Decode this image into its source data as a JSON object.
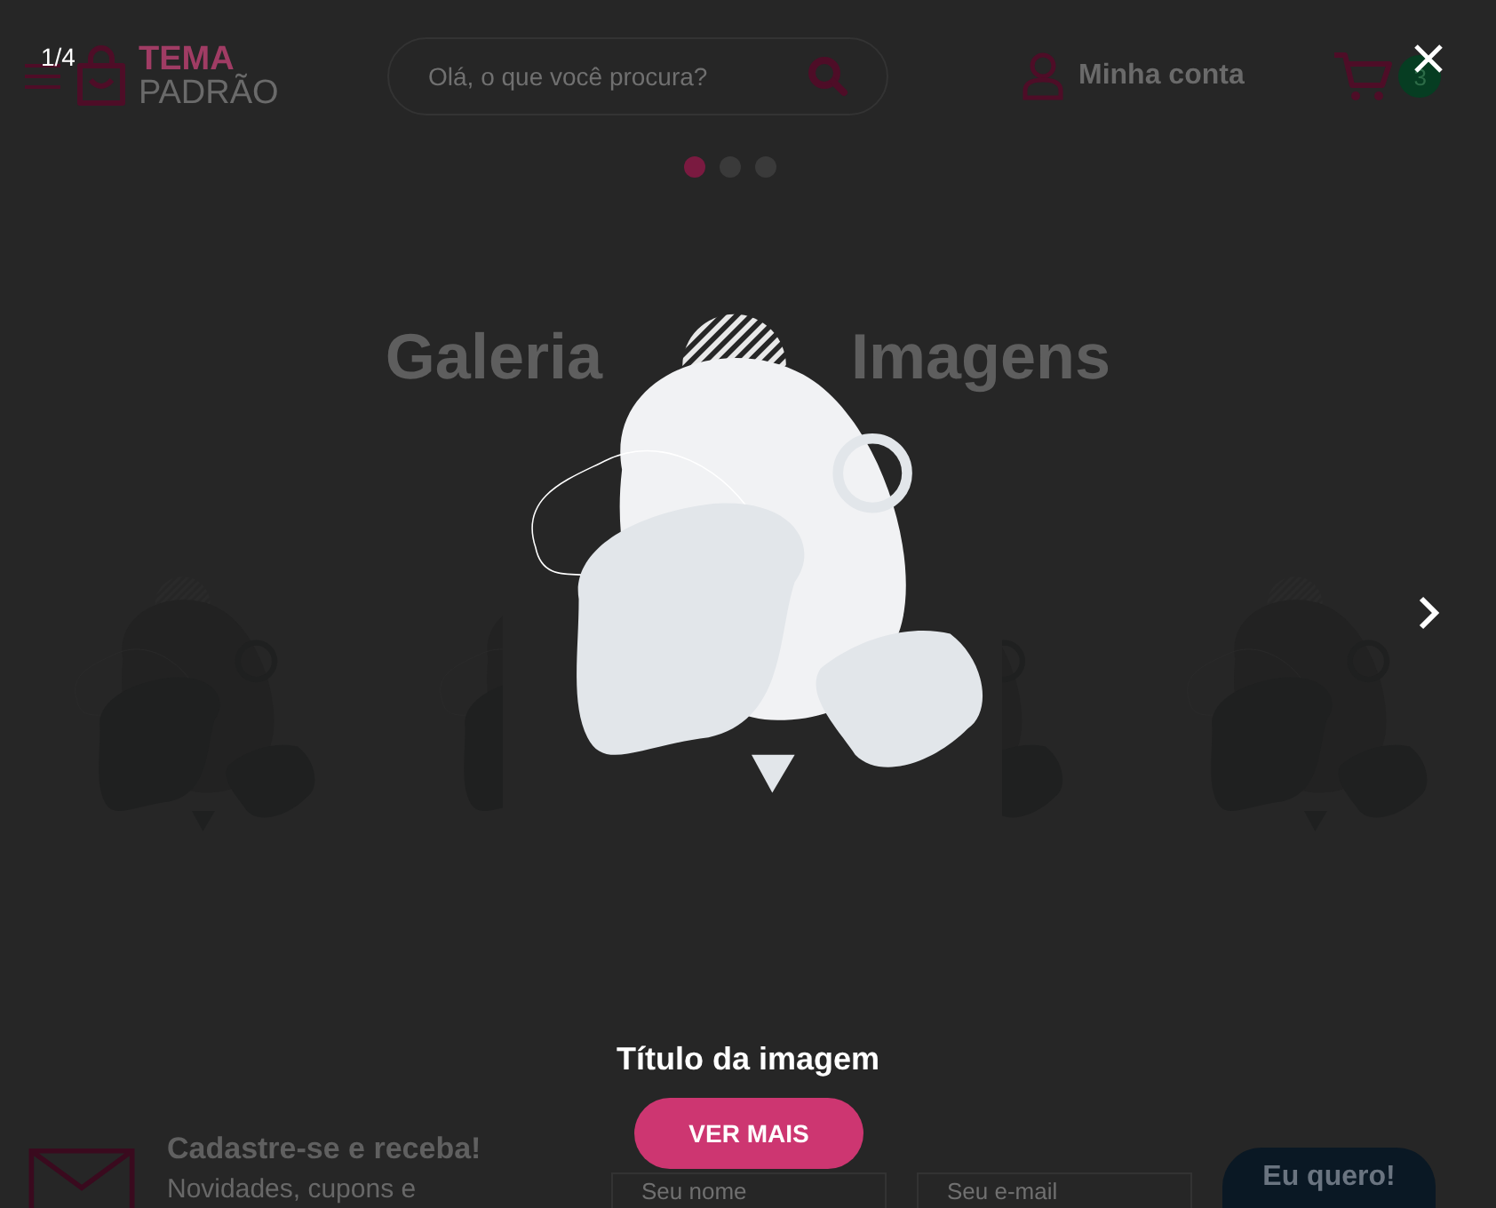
{
  "header": {
    "logo": {
      "line_1": "TEMA",
      "line_2": "PADRÃO"
    },
    "search": {
      "placeholder": "Olá, o que você procura?"
    },
    "account": "Minha conta",
    "cart_count": "3"
  },
  "banner_dots": [
    {
      "selected": true
    },
    {
      "selected": false
    },
    {
      "selected": false
    }
  ],
  "gallery": {
    "title_parts": [
      "Galeria",
      "Imagens"
    ],
    "thumbnails": [
      {
        "kind": "picture"
      },
      {
        "kind": "picture"
      },
      {
        "kind": "picture"
      },
      {
        "kind": "picture"
      }
    ]
  },
  "newsletter": {
    "title": "Cadastre-se e receba!",
    "text": "Novidades, cupons e",
    "name_field": {
      "placeholder": "Seu nome"
    },
    "email_field": {
      "placeholder": "Seu e-mail"
    },
    "button": "Eu quero!"
  },
  "lightbox": {
    "counter": "1/4",
    "image": {
      "kind": "picture"
    },
    "caption": "Título da imagem",
    "button": "VER MAIS"
  }
}
